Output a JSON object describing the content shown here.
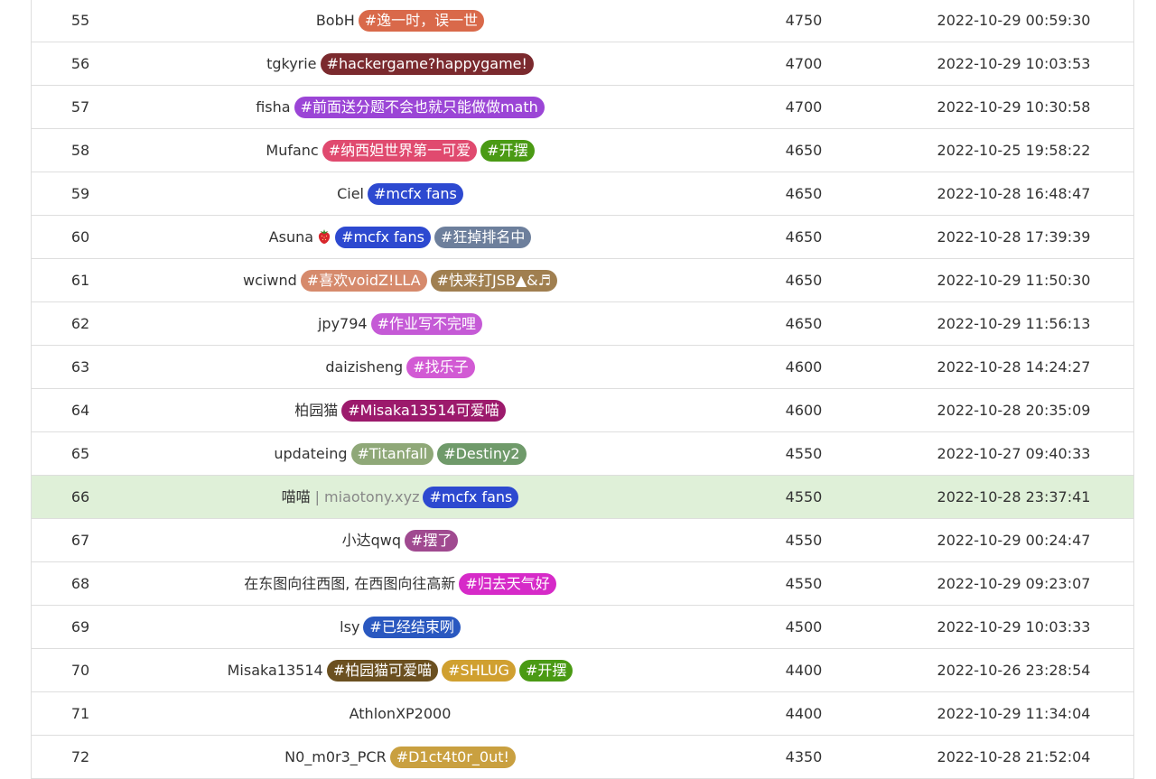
{
  "rows": [
    {
      "rank": "55",
      "name": "BobH",
      "tags": [
        {
          "text": "#逸一时，误一世",
          "color": "#d9694a"
        }
      ],
      "score": "4750",
      "time": "2022-10-29 00:59:30"
    },
    {
      "rank": "56",
      "name": "tgkyrie",
      "tags": [
        {
          "text": "#hackergame?happygame!",
          "color": "#7b2a2e"
        }
      ],
      "score": "4700",
      "time": "2022-10-29 10:03:53"
    },
    {
      "rank": "57",
      "name": "fisha",
      "tags": [
        {
          "text": "#前面送分题不会也就只能做做math",
          "color": "#9b45d6"
        }
      ],
      "score": "4700",
      "time": "2022-10-29 10:30:58"
    },
    {
      "rank": "58",
      "name": "Mufanc",
      "tags": [
        {
          "text": "#纳西妲世界第一可爱",
          "color": "#e04a6f"
        },
        {
          "text": "#开摆",
          "color": "#4a9a14"
        }
      ],
      "score": "4650",
      "time": "2022-10-25 19:58:22"
    },
    {
      "rank": "59",
      "name": "Ciel",
      "tags": [
        {
          "text": "#mcfx fans",
          "color": "#2d49d0"
        }
      ],
      "score": "4650",
      "time": "2022-10-28 16:48:47"
    },
    {
      "rank": "60",
      "name": "Asuna",
      "emoji": "strawberry-icon",
      "tags": [
        {
          "text": "#mcfx fans",
          "color": "#2d49d0"
        },
        {
          "text": "#狂掉排名中",
          "color": "#6d7f9c"
        }
      ],
      "score": "4650",
      "time": "2022-10-28 17:39:39"
    },
    {
      "rank": "61",
      "name": "wciwnd",
      "tags": [
        {
          "text": "#喜欢voidZ!LLA",
          "color": "#d68a6c"
        },
        {
          "text": "#快来打JSB▲&♬",
          "color": "#a07f50"
        }
      ],
      "score": "4650",
      "time": "2022-10-29 11:50:30"
    },
    {
      "rank": "62",
      "name": "jpy794",
      "tags": [
        {
          "text": "#作业写不完哩",
          "color": "#c55ad6"
        }
      ],
      "score": "4650",
      "time": "2022-10-29 11:56:13"
    },
    {
      "rank": "63",
      "name": "daizisheng",
      "tags": [
        {
          "text": "#找乐子",
          "color": "#d25ad4"
        }
      ],
      "score": "4600",
      "time": "2022-10-28 14:24:27"
    },
    {
      "rank": "64",
      "name": "柏园猫",
      "tags": [
        {
          "text": "#Misaka13514可爱喵",
          "color": "#9c1a6c"
        }
      ],
      "score": "4600",
      "time": "2022-10-28 20:35:09"
    },
    {
      "rank": "65",
      "name": "updateing",
      "tags": [
        {
          "text": "#Titanfall",
          "color": "#8fa878"
        },
        {
          "text": "#Destiny2",
          "color": "#6f9a6a"
        }
      ],
      "score": "4550",
      "time": "2022-10-27 09:40:33"
    },
    {
      "rank": "66",
      "name": "喵喵",
      "site": "miaotony.xyz",
      "highlight": true,
      "tags": [
        {
          "text": "#mcfx fans",
          "color": "#2d49d0"
        }
      ],
      "score": "4550",
      "time": "2022-10-28 23:37:41"
    },
    {
      "rank": "67",
      "name": "小达qwq",
      "tags": [
        {
          "text": "#摆了",
          "color": "#a04a90"
        }
      ],
      "score": "4550",
      "time": "2022-10-29 00:24:47"
    },
    {
      "rank": "68",
      "name": "在东图向往西图, 在西图向往高新",
      "tags": [
        {
          "text": "#归去天气好",
          "color": "#d62ac8"
        }
      ],
      "score": "4550",
      "time": "2022-10-29 09:23:07"
    },
    {
      "rank": "69",
      "name": "lsy",
      "tags": [
        {
          "text": "#已经结束咧",
          "color": "#2a58c0"
        }
      ],
      "score": "4500",
      "time": "2022-10-29 10:03:33"
    },
    {
      "rank": "70",
      "name": "Misaka13514",
      "tags": [
        {
          "text": "#柏园猫可爱喵",
          "color": "#6b5020"
        },
        {
          "text": "#SHLUG",
          "color": "#d0a030"
        },
        {
          "text": "#开摆",
          "color": "#4a9a14"
        }
      ],
      "score": "4400",
      "time": "2022-10-26 23:28:54"
    },
    {
      "rank": "71",
      "name": "AthlonXP2000",
      "tags": [],
      "score": "4400",
      "time": "2022-10-29 11:34:04"
    },
    {
      "rank": "72",
      "name": "N0_m0r3_PCR",
      "tags": [
        {
          "text": "#D1ct4t0r_0ut!",
          "color": "#c9a040"
        }
      ],
      "score": "4350",
      "time": "2022-10-28 21:52:04"
    }
  ],
  "separator": "|"
}
